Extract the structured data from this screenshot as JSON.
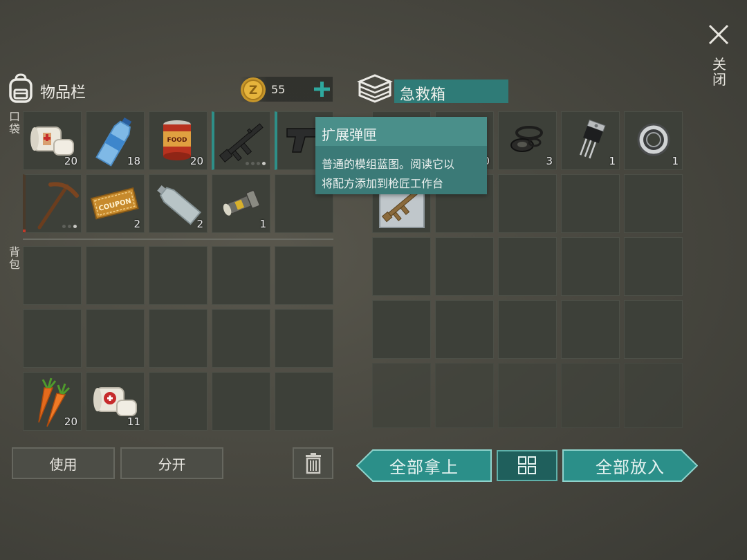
{
  "close_label": "关闭",
  "inventory": {
    "title": "物品栏",
    "coins": "55",
    "pocket_label": "口袋",
    "backpack_label": "背包",
    "pocket_slots": [
      {
        "icon": "bandage-icon",
        "qty": "20"
      },
      {
        "icon": "water-bottle-icon",
        "qty": "18"
      },
      {
        "icon": "food-can-icon",
        "qty": "20"
      },
      {
        "icon": "assault-rifle-icon",
        "qty": ""
      },
      {
        "icon": "pistol-icon",
        "qty": ""
      },
      {
        "icon": "pickaxe-icon",
        "qty": ""
      },
      {
        "icon": "coupon-icon",
        "qty": "2"
      },
      {
        "icon": "empty-bottle-icon",
        "qty": "2"
      },
      {
        "icon": "flashlight-icon",
        "qty": "1"
      },
      {
        "icon": "",
        "qty": ""
      }
    ],
    "backpack_slots": [
      {
        "icon": "carrot-icon",
        "qty": "20"
      },
      {
        "icon": "bandage-icon",
        "qty": "11"
      }
    ],
    "coupon_text": "COUPON",
    "can_label": "FOOD",
    "use_label": "使用",
    "split_label": "分开"
  },
  "container": {
    "title": "急救箱",
    "slots": [
      {
        "icon": "blueprint-icon",
        "qty": ""
      },
      {
        "icon": "blueprint-icon",
        "qty": "10"
      },
      {
        "icon": "rubber-seals-icon",
        "qty": "3"
      },
      {
        "icon": "transistor-icon",
        "qty": "1"
      },
      {
        "icon": "bearing-icon",
        "qty": "1"
      },
      {
        "icon": "rifle-blueprint-icon",
        "qty": ""
      }
    ],
    "take_all_label": "全部拿上",
    "put_all_label": "全部放入"
  },
  "tooltip": {
    "title": "扩展弹匣",
    "description_line1": "普通的模组蓝图。阅读它以",
    "description_line2": "将配方添加到枪匠工作台"
  },
  "colors": {
    "teal": "#2b8f89",
    "teal_dark": "#1d5f5c",
    "tooltip_bg": "#3b7a77",
    "slot_bg": "#3d4039"
  }
}
